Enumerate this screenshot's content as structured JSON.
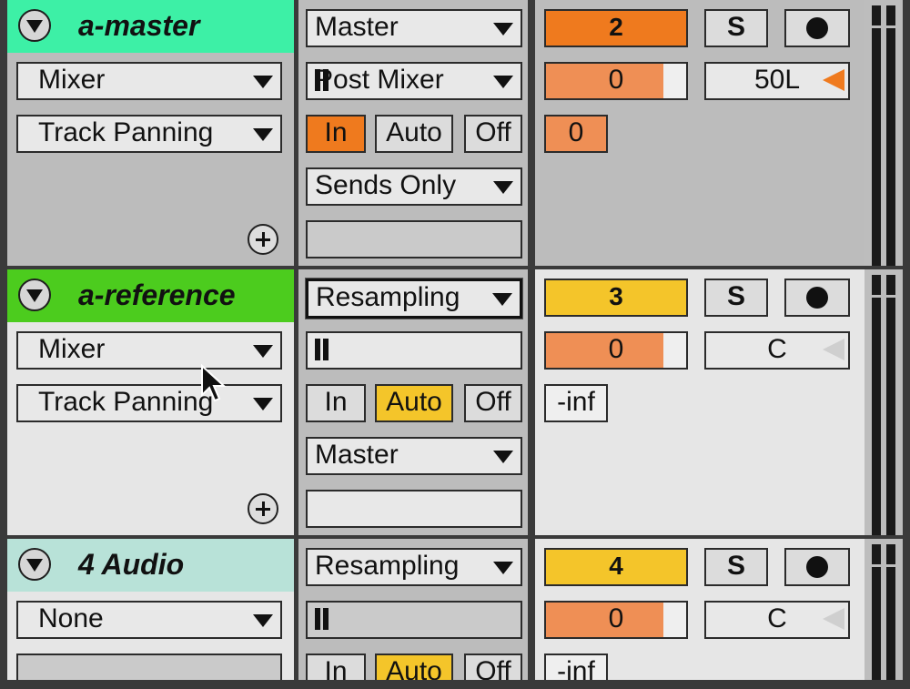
{
  "tracks": [
    {
      "name": "a-master",
      "header_color": "#3df0a6",
      "input_type": "Mixer",
      "input_channel": "Track Panning",
      "output_type": "Master",
      "output_channel": "Post Mixer",
      "monitor": {
        "in": "In",
        "auto": "Auto",
        "off": "Off",
        "active": "in"
      },
      "sends_dropdown": "Sends Only",
      "track_number": "2",
      "solo": "S",
      "volume": "0",
      "volume_level": 0.85,
      "pan": "50L",
      "send": "0"
    },
    {
      "name": "a-reference",
      "header_color": "#4ccc1e",
      "input_type": "Mixer",
      "input_channel": "Track Panning",
      "output_type": "Resampling",
      "output_channel": "",
      "monitor": {
        "in": "In",
        "auto": "Auto",
        "off": "Off",
        "active": "auto"
      },
      "sends_dropdown": "Master",
      "track_number": "3",
      "solo": "S",
      "volume": "0",
      "volume_level": 0.85,
      "pan": "C",
      "send": "-inf"
    },
    {
      "name": "4 Audio",
      "header_color": "#b8e2d8",
      "input_type": "None",
      "input_channel": "",
      "output_type": "Resampling",
      "output_channel": "",
      "monitor": {
        "in": "In",
        "auto": "Auto",
        "off": "Off",
        "active": "auto"
      },
      "track_number": "4",
      "solo": "S",
      "volume": "0",
      "volume_level": 0.85,
      "pan": "C",
      "send": "-inf"
    }
  ]
}
